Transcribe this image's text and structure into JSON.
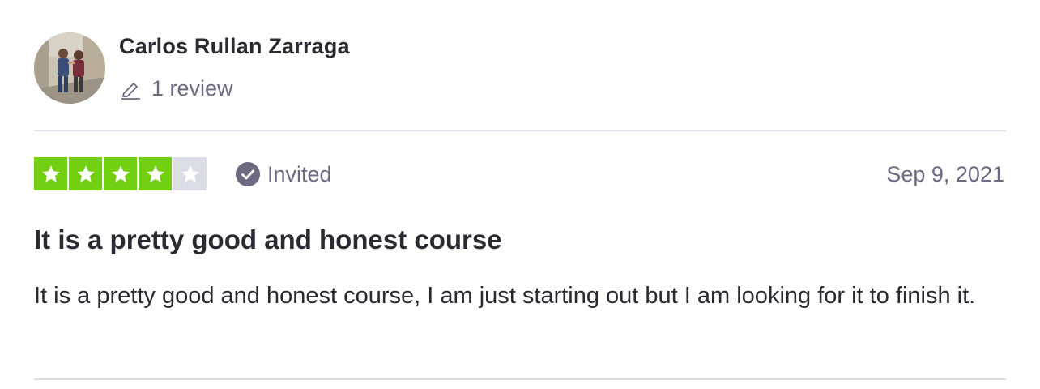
{
  "reviewer": {
    "name": "Carlos Rullan Zarraga",
    "review_count": "1 review",
    "avatar_icon": "user-photo-avatar"
  },
  "rating": {
    "stars": 4,
    "max": 5,
    "filled_color": "#73cf11",
    "empty_color": "#dcdce6"
  },
  "status": {
    "label": "Invited",
    "icon": "check-circle-icon"
  },
  "review": {
    "date": "Sep 9, 2021",
    "title": "It is a pretty good and honest course",
    "body": "It is a pretty good and honest course, I am just starting out but I am looking for it to finish it."
  }
}
